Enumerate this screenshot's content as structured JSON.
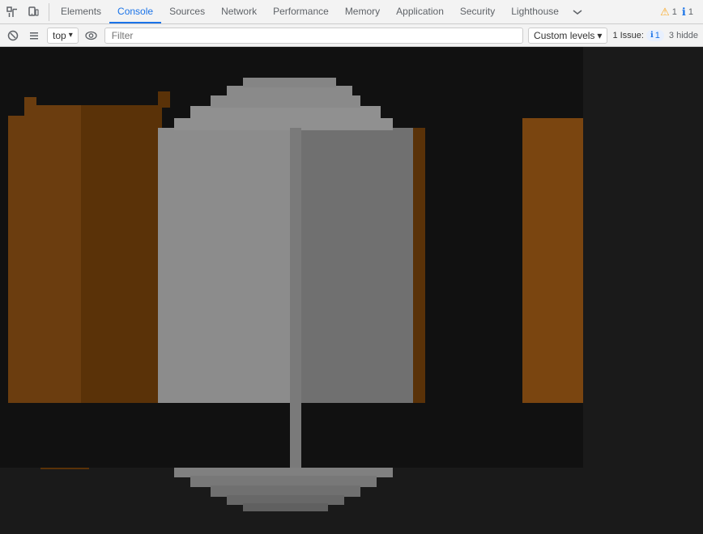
{
  "tabs": [
    {
      "id": "elements",
      "label": "Elements",
      "active": false
    },
    {
      "id": "console",
      "label": "Console",
      "active": true
    },
    {
      "id": "sources",
      "label": "Sources",
      "active": false
    },
    {
      "id": "network",
      "label": "Network",
      "active": false
    },
    {
      "id": "performance",
      "label": "Performance",
      "active": false
    },
    {
      "id": "memory",
      "label": "Memory",
      "active": false
    },
    {
      "id": "application",
      "label": "Application",
      "active": false
    },
    {
      "id": "security",
      "label": "Security",
      "active": false
    },
    {
      "id": "lighthouse",
      "label": "Lighthouse",
      "active": false
    }
  ],
  "toolbar": {
    "inspect_label": "Inspect element",
    "device_label": "Toggle device toolbar",
    "overflow_label": "More tabs"
  },
  "alerts": {
    "warning_count": "1",
    "info_count": "1"
  },
  "console_toolbar": {
    "clear_label": "Clear console",
    "context_label": "top",
    "eye_label": "Show live expressions",
    "filter_placeholder": "Filter",
    "levels_label": "Custom levels",
    "levels_arrow": "▾",
    "issue_label": "1 Issue:",
    "issue_count": "1",
    "hidden_label": "3 hidde"
  }
}
